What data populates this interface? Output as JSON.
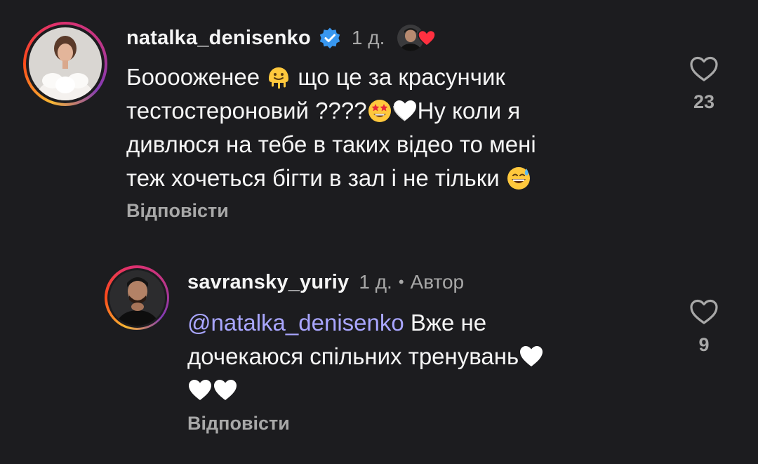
{
  "comments": [
    {
      "username": "natalka_denisenko",
      "verified": true,
      "time": "1 д.",
      "liked_by_author": true,
      "lines": [
        {
          "t1": "Бооооженее ",
          "e1": "melting-face",
          "t2": "  що це за красунчик"
        },
        {
          "t1": "тестостероновий ????",
          "e1": "star-struck",
          "e2": "white-heart",
          "t2": "Ну коли я"
        },
        {
          "t1": "дивлюся на тебе в таких відео то мені"
        },
        {
          "t1": "теж хочеться бігти в зал і не тільки ",
          "e1": "grinning-sweat"
        }
      ],
      "reply_label": "Відповісти",
      "like_count": "23"
    },
    {
      "username": "savransky_yuriy",
      "time": "1 д.",
      "separator": "•",
      "author_tag": "Автор",
      "mention": "@natalka_denisenko",
      "lines": [
        {
          "t1": " Вже не"
        },
        {
          "t1": "дочекаюся спільних тренувань",
          "e1": "white-heart"
        },
        {
          "e1": "white-heart",
          "e2": "white-heart"
        }
      ],
      "reply_label": "Відповісти",
      "like_count": "9"
    }
  ],
  "colors": {
    "background": "#1c1c1f",
    "text": "#f5f5f5",
    "secondary": "#a8a8a8",
    "mention": "#a9a6ff",
    "verified": "#3897f0",
    "heart_red": "#ff3040"
  }
}
